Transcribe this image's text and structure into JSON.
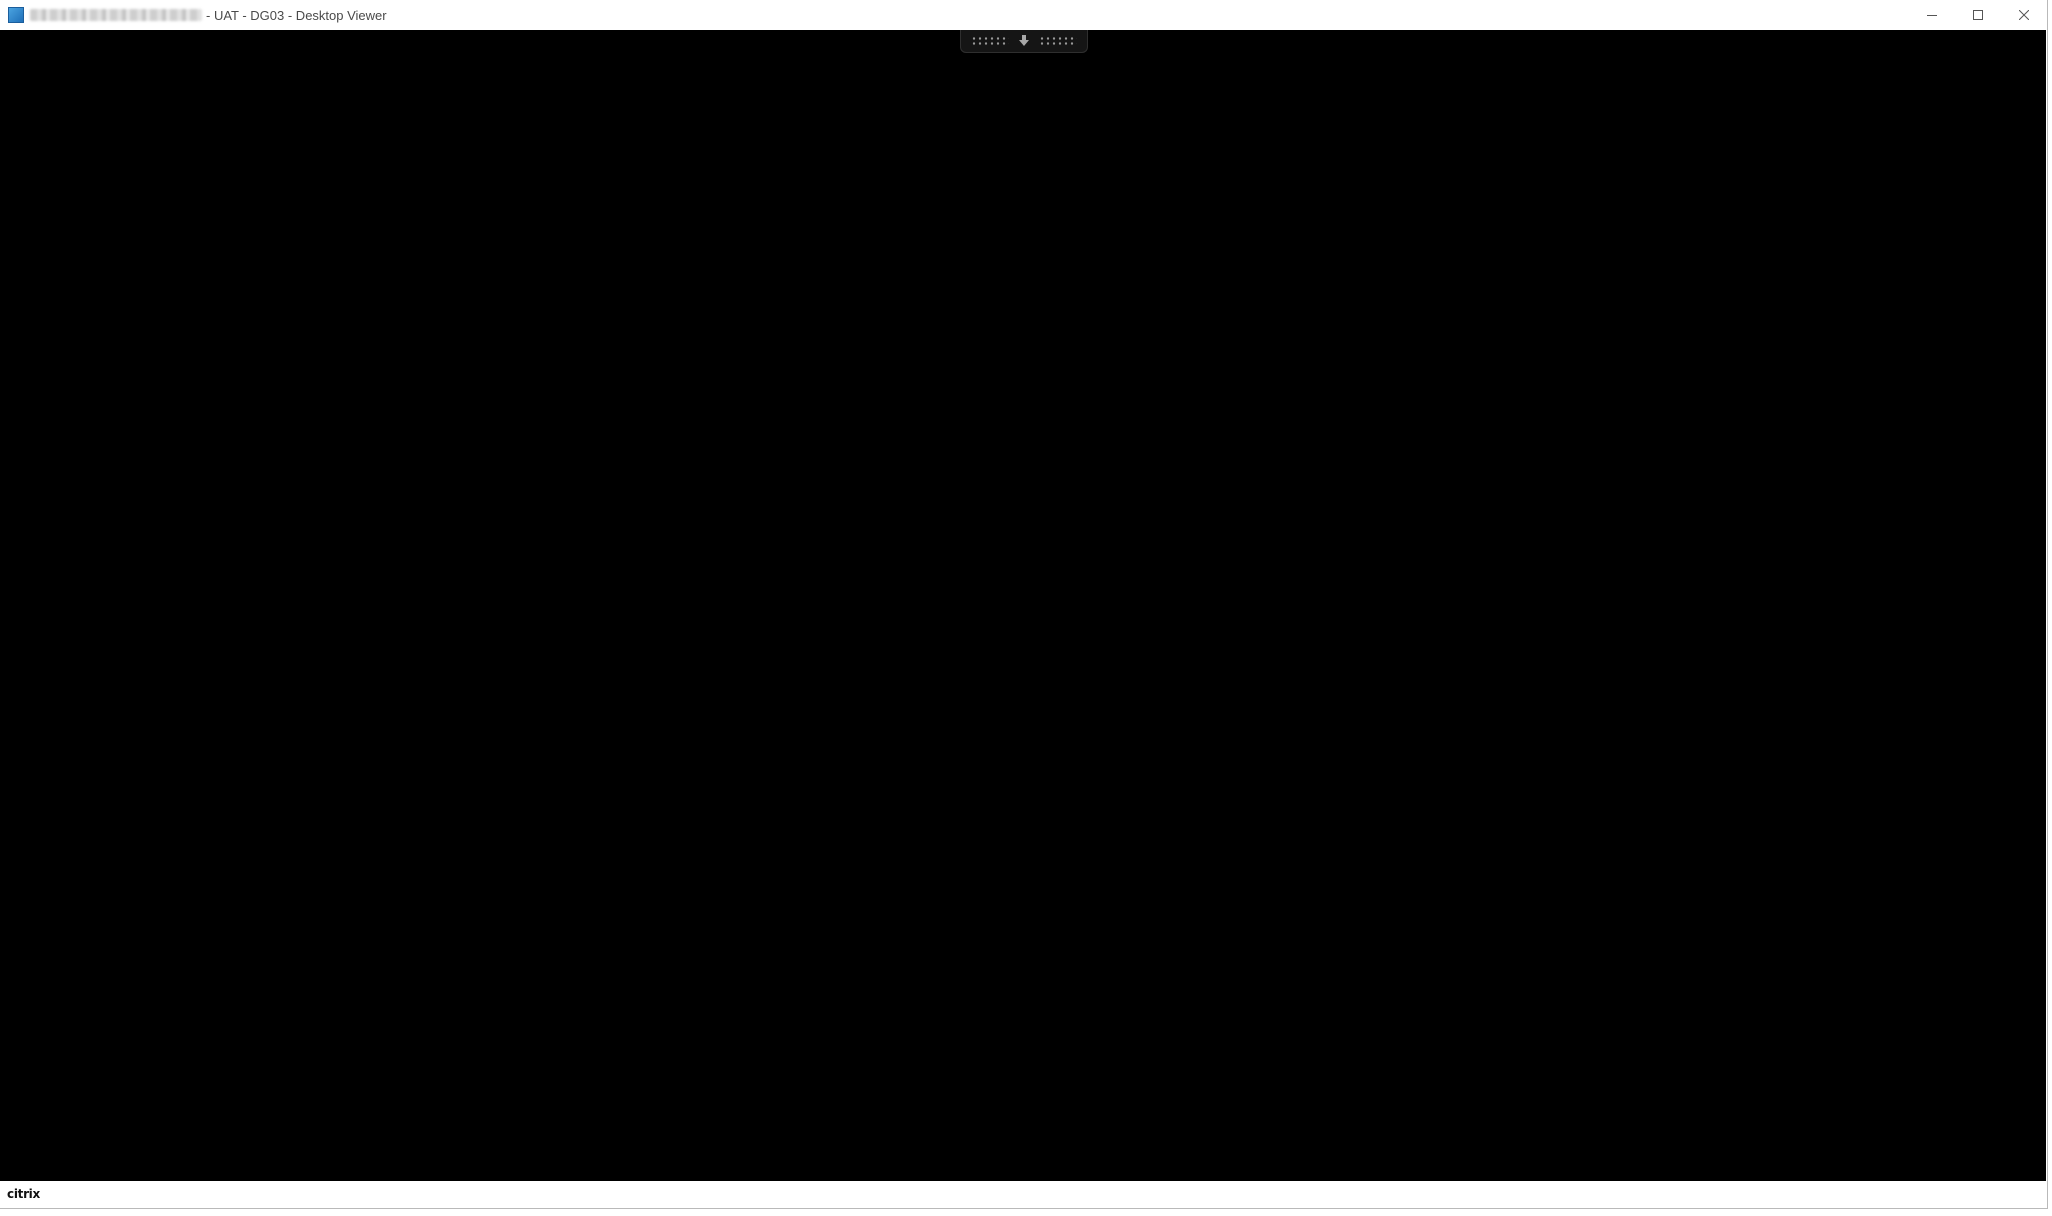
{
  "window": {
    "title_suffix": "- UAT - DG03 - Desktop Viewer",
    "controls": {
      "minimize": "minimize-icon",
      "maximize": "maximize-icon",
      "close": "close-icon"
    }
  },
  "status_bar": {
    "logo_text": "citrix"
  },
  "colors": {
    "viewport_background": "#000000",
    "titlebar_background": "#ffffff",
    "accent_icon": "#1f6fb8"
  }
}
